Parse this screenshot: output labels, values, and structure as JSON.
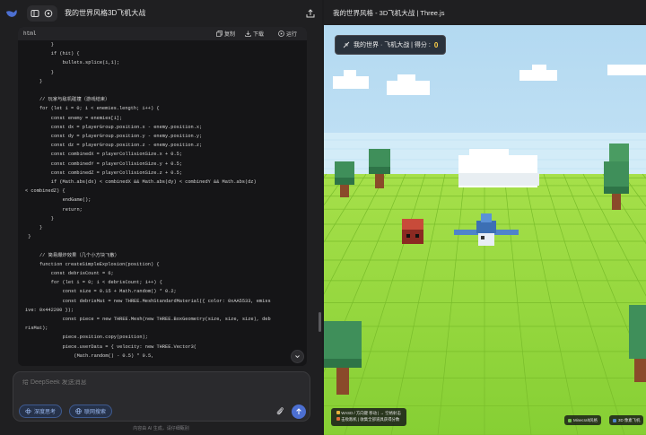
{
  "app": {
    "conversation_title": "我的世界风格3D飞机大战",
    "footer_note": "内容由 AI 生成，请仔细甄别"
  },
  "code_block": {
    "language": "html",
    "actions": {
      "copy": "复制",
      "download": "下载",
      "run": "运行"
    },
    "lines": [
      {
        "i": 9,
        "t": "}"
      },
      {
        "i": 9,
        "t": "if (hit) {"
      },
      {
        "i": 13,
        "t": "bullets.splice(i,1);"
      },
      {
        "i": 9,
        "t": "}"
      },
      {
        "i": 5,
        "t": "}"
      },
      {
        "i": 0,
        "t": ""
      },
      {
        "i": 5,
        "t": "// 玩家与敌机碰撞（游戏结束）"
      },
      {
        "i": 5,
        "t": "for (let i = 0; i < enemies.length; i++) {"
      },
      {
        "i": 9,
        "t": "const enemy = enemies[i];"
      },
      {
        "i": 9,
        "t": "const dx = playerGroup.position.x - enemy.position.x;"
      },
      {
        "i": 9,
        "t": "const dy = playerGroup.position.y - enemy.position.y;"
      },
      {
        "i": 9,
        "t": "const dz = playerGroup.position.z - enemy.position.z;"
      },
      {
        "i": 9,
        "t": "const combinedX = playerCollisionSize.x + 0.5;"
      },
      {
        "i": 9,
        "t": "const combinedY = playerCollisionSize.y + 0.5;"
      },
      {
        "i": 9,
        "t": "const combinedZ = playerCollisionSize.z + 0.5;"
      },
      {
        "i": 9,
        "t": "if (Math.abs(dx) < combinedX && Math.abs(dy) < combinedY && Math.abs(dz)"
      },
      {
        "i": 0,
        "t": "< combinedZ) {"
      },
      {
        "i": 13,
        "t": "endGame();"
      },
      {
        "i": 13,
        "t": "return;"
      },
      {
        "i": 9,
        "t": "}"
      },
      {
        "i": 5,
        "t": "}"
      },
      {
        "i": 1,
        "t": "}"
      },
      {
        "i": 0,
        "t": ""
      },
      {
        "i": 5,
        "t": "// 简易爆炸效果（几个小方块飞散）"
      },
      {
        "i": 5,
        "t": "function createSimpleExplosion(position) {"
      },
      {
        "i": 9,
        "t": "const debrisCount = 6;"
      },
      {
        "i": 9,
        "t": "for (let i = 0; i < debrisCount; i++) {"
      },
      {
        "i": 13,
        "t": "const size = 0.15 + Math.random() * 0.2;"
      },
      {
        "i": 13,
        "t": "const debrisMat = new THREE.MeshStandardMaterial({ color: 0xAA5533, emiss"
      },
      {
        "i": 0,
        "t": "ive: 0x442200 });"
      },
      {
        "i": 13,
        "t": "const piece = new THREE.Mesh(new THREE.BoxGeometry(size, size, size), deb"
      },
      {
        "i": 0,
        "t": "risMat);"
      },
      {
        "i": 13,
        "t": "piece.position.copy(position);"
      },
      {
        "i": 13,
        "t": "piece.userData = { velocity: new THREE.Vector3("
      },
      {
        "i": 17,
        "t": "(Math.random() - 0.5) * 0.5,"
      }
    ]
  },
  "chat": {
    "placeholder": "给 DeepSeek 发送消息",
    "deep_think": "深度思考",
    "web_search": "联网搜索"
  },
  "preview": {
    "title": "我的世界风格 - 3D飞机大战 | Three.js",
    "hud": {
      "label": "我的世界 · 飞机大战 | 得分 :",
      "score": "0"
    },
    "controls": {
      "line1": "WASD / 方向键 移动 | → 空格射击",
      "line2": "击败敌机 | 收集全部道具获得分数"
    },
    "tag_left": "Minecraft风格",
    "tag_right": "3D 像素飞机"
  },
  "colors": {
    "sky_top": "#b5dbf2",
    "sky_bottom": "#d9eefb",
    "grass": "#8fd43a",
    "grass_line": "#79bd2b",
    "accent": "#4c6fd1",
    "score": "#ffd24a"
  }
}
